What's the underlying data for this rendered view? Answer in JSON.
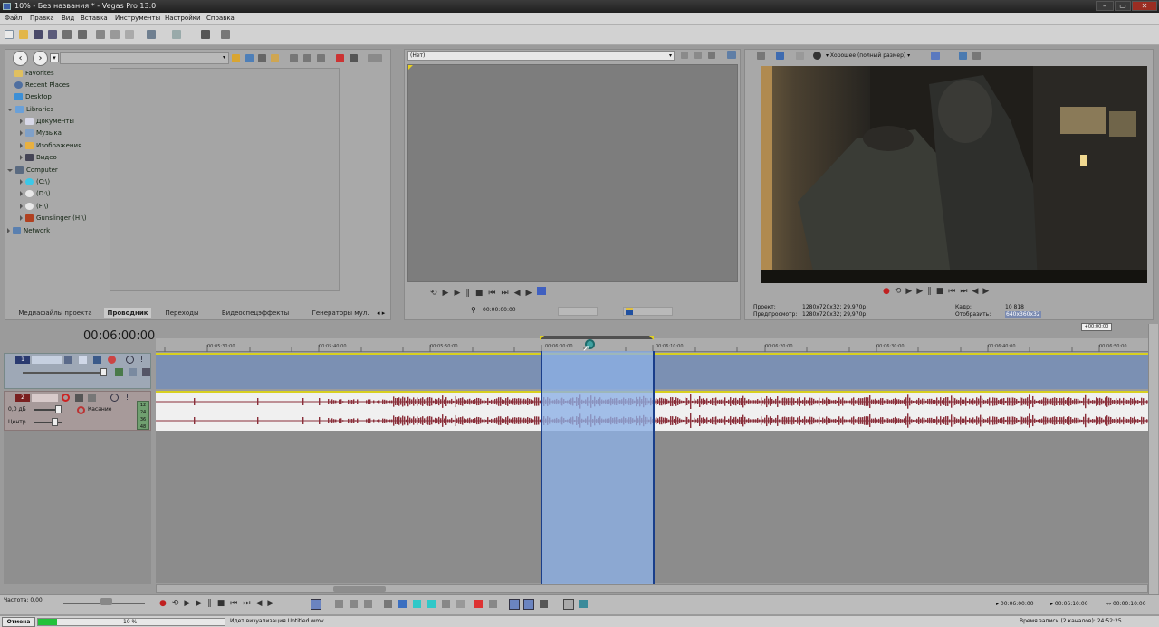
{
  "window": {
    "title": "10% - Без названия * - Vegas Pro 13.0"
  },
  "menu": [
    "Файл",
    "Правка",
    "Вид",
    "Вставка",
    "Инструменты",
    "Настройки",
    "Справка"
  ],
  "explorer": {
    "tree": [
      {
        "label": "Favorites",
        "icon": "star-folder-icon",
        "level": 1
      },
      {
        "label": "Recent Places",
        "icon": "recent-places-icon",
        "level": 1
      },
      {
        "label": "Desktop",
        "icon": "desktop-icon",
        "level": 1
      },
      {
        "label": "Libraries",
        "icon": "libraries-icon",
        "level": 0,
        "expanded": true
      },
      {
        "label": "Документы",
        "icon": "documents-icon",
        "level": 2
      },
      {
        "label": "Музыка",
        "icon": "music-icon",
        "level": 2
      },
      {
        "label": "Изображения",
        "icon": "pictures-icon",
        "level": 2
      },
      {
        "label": "Видео",
        "icon": "video-icon",
        "level": 2
      },
      {
        "label": "Computer",
        "icon": "computer-icon",
        "level": 0,
        "expanded": true
      },
      {
        "label": "(C:\\)",
        "icon": "drive-icon",
        "level": 2
      },
      {
        "label": "(D:\\)",
        "icon": "drive-icon",
        "level": 2
      },
      {
        "label": "(F:\\)",
        "icon": "drive-icon",
        "level": 2
      },
      {
        "label": "Gunslinger (H:\\)",
        "icon": "gunslinger-drive-icon",
        "level": 2
      },
      {
        "label": "Network",
        "icon": "network-icon",
        "level": 0
      }
    ],
    "tabs": [
      "Медиафайлы проекта",
      "Проводник",
      "Переходы",
      "Видеоспецэффекты",
      "Генераторы мул."
    ],
    "active_tab": "Проводник"
  },
  "trimmer": {
    "dropdown_value": "(Нет)",
    "timecode": "00:00:00:00"
  },
  "preview": {
    "quality": "Хорошее (полный размер)",
    "project_label": "Проект:",
    "project_value": "1280x720x32; 29,970p",
    "preview_label": "Предпросмотр:",
    "preview_value": "1280x720x32; 29,970p",
    "frame_label": "Кадр:",
    "frame_value": "10 818",
    "display_label": "Отобразить:",
    "display_value": "640x360x32"
  },
  "timeline": {
    "timecode": "00:06:00:00",
    "marker_label": "+00:00:00",
    "ruler": [
      "00:05:30:00",
      "00:05:40:00",
      "00:05:50:00",
      "00:06:00:00",
      "00:06:10:00",
      "00:06:20:00",
      "00:06:30:00",
      "00:06:40:00",
      "00:06:50:00"
    ],
    "video_track_number": "1",
    "audio_track_number": "2",
    "audio_volume": "0,0 дБ",
    "audio_mode": "Касание",
    "audio_pan": "Центр",
    "meter_labels": [
      "12",
      "24",
      "36",
      "48"
    ]
  },
  "bottom": {
    "rate_label": "Частота: 0,00",
    "sel_start": "00:06:00:00",
    "sel_end": "00:06:10:00",
    "sel_length": "00:00:10:00"
  },
  "status": {
    "cancel_label": "Отмена",
    "progress_percent": 10,
    "progress_text": "10 %",
    "message": "Идет визуализация Untitled.wmv",
    "record_time": "Время записи (2 каналов): 24:52:25"
  },
  "colors": {
    "selection": "#8cafe6",
    "audio_wave": "#8a2f3a",
    "video_track": "#7b90b3",
    "progress": "#22c23a"
  }
}
